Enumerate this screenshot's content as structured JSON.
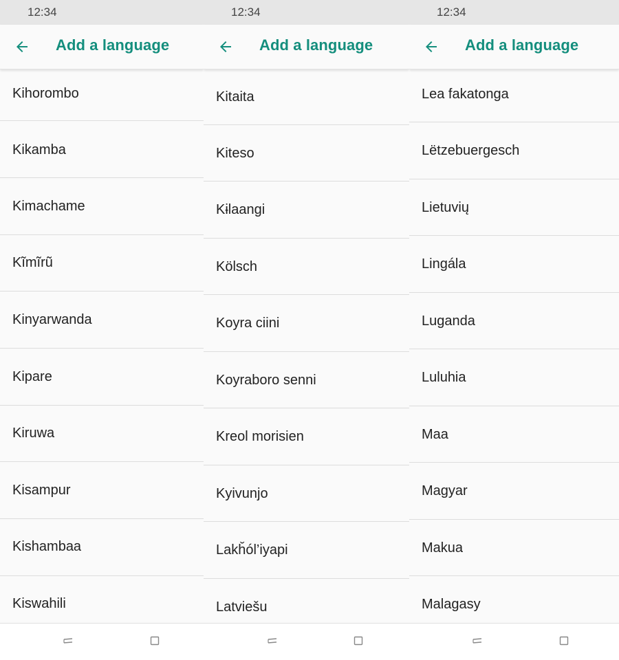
{
  "colors": {
    "accent": "#148e7d",
    "status_bar": "#e6e6e6",
    "background": "#fafafa",
    "divider": "#dcdcdc"
  },
  "panels": [
    {
      "status": {
        "time": "12:34"
      },
      "appbar": {
        "back_icon": "arrow-left-icon",
        "title": "Add a language"
      },
      "items": [
        "Kihorombo",
        "Kikamba",
        "Kimachame",
        "Kĩmĩrũ",
        "Kinyarwanda",
        "Kipare",
        "Kiruwa",
        "Kisampur",
        "Kishambaa",
        "Kiswahili"
      ],
      "nav": {
        "recents_icon": "recents-icon",
        "home_icon": "square-icon"
      }
    },
    {
      "status": {
        "time": "12:34"
      },
      "appbar": {
        "back_icon": "arrow-left-icon",
        "title": "Add a language"
      },
      "items": [
        "Kitaita",
        "Kiteso",
        "Kɨlaangi",
        "Kölsch",
        "Koyra ciini",
        "Koyraboro senni",
        "Kreol morisien",
        "Kyivunjo",
        "Lakȟól’iyapi",
        "Latviešu"
      ],
      "nav": {
        "recents_icon": "recents-icon",
        "home_icon": "square-icon"
      }
    },
    {
      "status": {
        "time": "12:34"
      },
      "appbar": {
        "back_icon": "arrow-left-icon",
        "title": "Add a language"
      },
      "items": [
        "Lea fakatonga",
        "Lëtzebuergesch",
        "Lietuvių",
        "Lingála",
        "Luganda",
        "Luluhia",
        "Maa",
        "Magyar",
        "Makua",
        "Malagasy"
      ],
      "nav": {
        "recents_icon": "recents-icon",
        "home_icon": "square-icon"
      }
    }
  ]
}
